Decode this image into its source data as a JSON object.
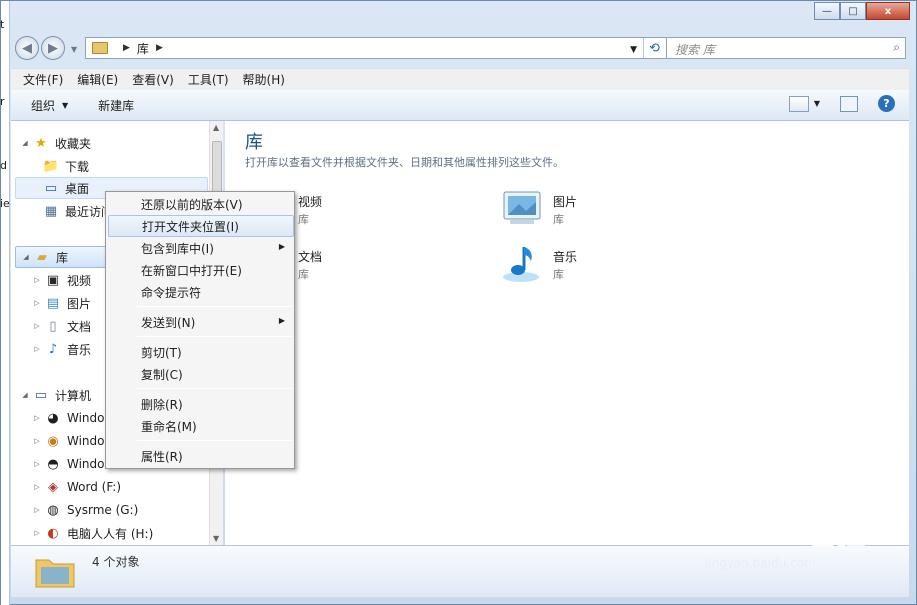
{
  "window": {
    "title_buttons": {
      "minimize": "—",
      "maximize": "□",
      "close": "x"
    },
    "left_strip_glyphs": [
      "t",
      "r",
      "d",
      "ie"
    ]
  },
  "address": {
    "path": [
      "库"
    ],
    "search_placeholder": "搜索 库"
  },
  "menu": [
    "文件(F)",
    "编辑(E)",
    "查看(V)",
    "工具(T)",
    "帮助(H)"
  ],
  "toolbar": {
    "organize": "组织",
    "new_library": "新建库"
  },
  "navigation": {
    "favorites": {
      "label": "收藏夹",
      "items": [
        "下载",
        "桌面",
        "最近访问"
      ]
    },
    "libraries": {
      "label": "库",
      "items": [
        "视频",
        "图片",
        "文档",
        "音乐"
      ]
    },
    "computer": {
      "label": "计算机",
      "items": [
        "Windov",
        "Windov",
        "Windov",
        "Word (F:)",
        "Sysrme (G:)",
        "电脑人人有 (H:)"
      ]
    }
  },
  "library_pane": {
    "title": "库",
    "subtitle": "打开库以查看文件并根据文件夹、日期和其他属性排列这些文件。",
    "items": [
      {
        "name": "视频",
        "type": "库",
        "icon": "video-library-icon"
      },
      {
        "name": "图片",
        "type": "库",
        "icon": "picture-library-icon"
      },
      {
        "name": "文档",
        "type": "库",
        "icon": "document-library-icon"
      },
      {
        "name": "音乐",
        "type": "库",
        "icon": "music-library-icon"
      }
    ]
  },
  "status": {
    "count": "4 个对象"
  },
  "context_menu": [
    {
      "label": "还原以前的版本(V)",
      "highlight": false,
      "submenu": false
    },
    {
      "label": "打开文件夹位置(I)",
      "highlight": true,
      "submenu": false
    },
    {
      "label": "包含到库中(I)",
      "highlight": false,
      "submenu": true
    },
    {
      "label": "在新窗口中打开(E)",
      "highlight": false,
      "submenu": false
    },
    {
      "label": "命令提示符",
      "highlight": false,
      "submenu": false
    },
    {
      "label": "发送到(N)",
      "highlight": false,
      "submenu": true
    },
    {
      "label": "剪切(T)",
      "highlight": false,
      "submenu": false
    },
    {
      "label": "复制(C)",
      "highlight": false,
      "submenu": false
    },
    {
      "label": "删除(R)",
      "highlight": false,
      "submenu": false
    },
    {
      "label": "重命名(M)",
      "highlight": false,
      "submenu": false
    },
    {
      "label": "属性(R)",
      "highlight": false,
      "submenu": false
    }
  ],
  "watermark": {
    "brand": "Baidu 经验",
    "url": "jingyan.baidu.com"
  }
}
